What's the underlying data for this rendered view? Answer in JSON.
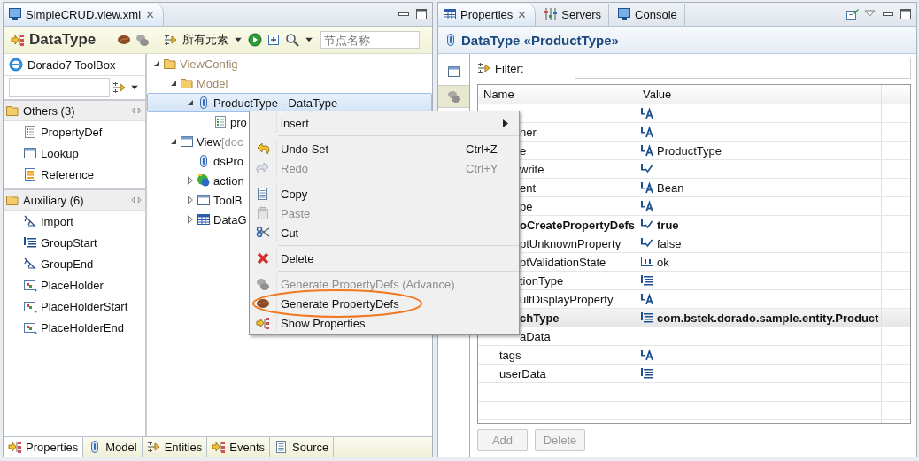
{
  "editor": {
    "tab": {
      "title": "SimpleCRUD.view.xml"
    },
    "toolbar": {
      "title": "DataType",
      "filter_label": "所有元素",
      "search_placeholder": "节点名称"
    },
    "toolbox": {
      "title": "Dorado7 ToolBox",
      "groups": [
        {
          "label": "Others (3)",
          "items": [
            "PropertyDef",
            "Lookup",
            "Reference"
          ]
        },
        {
          "label": "Auxiliary (6)",
          "items": [
            "Import",
            "GroupStart",
            "GroupEnd",
            "PlaceHolder",
            "PlaceHolderStart",
            "PlaceHolderEnd"
          ]
        }
      ]
    },
    "tree": [
      {
        "label": "ViewConfig",
        "expanded": true,
        "dim": true,
        "selected": false,
        "children": [
          {
            "label": "Model",
            "expanded": true,
            "dim": true,
            "selected": false,
            "children": [
              {
                "label": "ProductType - DataType",
                "expanded": true,
                "dim": false,
                "selected": true,
                "children": [
                  {
                    "label": "pro",
                    "dim": false,
                    "selected": false
                  }
                ]
              }
            ]
          },
          {
            "label": "View",
            "note": "[doc",
            "expanded": true,
            "dim": false,
            "selected": false,
            "children": [
              {
                "label": "dsPro",
                "dim": false,
                "selected": false
              },
              {
                "label": "action",
                "expanded": false,
                "dim": false,
                "selected": false
              },
              {
                "label": "ToolB",
                "expanded": false,
                "dim": false,
                "selected": false
              },
              {
                "label": "DataG",
                "expanded": false,
                "dim": false,
                "selected": false
              }
            ]
          }
        ]
      }
    ],
    "bottom_tabs": [
      {
        "label": "Properties",
        "selected": true
      },
      {
        "label": "Model",
        "selected": false
      },
      {
        "label": "Entities",
        "selected": false
      },
      {
        "label": "Events",
        "selected": false
      },
      {
        "label": "Source",
        "selected": false
      }
    ]
  },
  "properties": {
    "tabs": [
      {
        "label": "Properties",
        "selected": true
      },
      {
        "label": "Servers",
        "selected": false
      },
      {
        "label": "Console",
        "selected": false
      }
    ],
    "title": "DataType «ProductType»",
    "side_tabs": [
      {
        "selected": false
      },
      {
        "selected": true
      }
    ],
    "filter_label": "Filter:",
    "columns": [
      "Name",
      "Value"
    ],
    "rows": [
      {
        "kind": "text",
        "selected": false
      },
      {
        "name": "ner",
        "kind": "text",
        "clipped": true,
        "bold": false,
        "selected": false
      },
      {
        "name": "e",
        "kind": "text",
        "value": "ProductType",
        "clipped": true,
        "bold": false,
        "selected": false
      },
      {
        "name": "write",
        "kind": "bool",
        "clipped": true,
        "bold": false,
        "selected": false
      },
      {
        "name": "ent",
        "kind": "text",
        "value": "Bean",
        "clipped": true,
        "bold": false,
        "selected": false
      },
      {
        "name": "pe",
        "kind": "text",
        "clipped": true,
        "bold": false,
        "selected": false
      },
      {
        "name": "oCreatePropertyDefs",
        "kind": "bool",
        "value": "true",
        "clipped": true,
        "bold": true,
        "selected": false
      },
      {
        "name": "ptUnknownProperty",
        "kind": "bool",
        "value": "false",
        "clipped": true,
        "bold": false,
        "selected": false
      },
      {
        "name": "ptValidationState",
        "kind": "number",
        "value": "ok",
        "clipped": true,
        "bold": false,
        "selected": false
      },
      {
        "name": "tionType",
        "kind": "list",
        "clipped": true,
        "bold": false,
        "selected": false
      },
      {
        "name": "ultDisplayProperty",
        "kind": "text",
        "clipped": true,
        "bold": false,
        "selected": false
      },
      {
        "name": "chType",
        "kind": "list",
        "value": "com.bstek.dorado.sample.entity.Product",
        "clipped": true,
        "bold": true,
        "selected": true
      },
      {
        "name": "aData",
        "kind": "none",
        "clipped": true,
        "bold": false,
        "selected": false
      },
      {
        "name": "tags",
        "kind": "text",
        "clipped": false,
        "bold": false,
        "selected": false
      },
      {
        "name": "userData",
        "kind": "list",
        "clipped": false,
        "bold": false,
        "selected": false
      }
    ],
    "buttons": [
      {
        "label": "Add",
        "disabled": true
      },
      {
        "label": "Delete",
        "disabled": true
      }
    ]
  },
  "context_menu": {
    "groups": [
      [
        {
          "label": "insert",
          "submenu": true,
          "disabled": false,
          "circled": false
        }
      ],
      [
        {
          "label": "Undo Set",
          "shortcut": "Ctrl+Z",
          "disabled": false,
          "circled": false
        },
        {
          "label": "Redo",
          "shortcut": "Ctrl+Y",
          "disabled": true,
          "circled": false
        }
      ],
      [
        {
          "label": "Copy",
          "disabled": false,
          "circled": false
        },
        {
          "label": "Paste",
          "disabled": true,
          "circled": false
        },
        {
          "label": "Cut",
          "disabled": false,
          "circled": false
        }
      ],
      [
        {
          "label": "Delete",
          "disabled": false,
          "circled": false
        }
      ],
      [
        {
          "label": "Generate PropertyDefs (Advance)",
          "disabled": true,
          "circled": false
        },
        {
          "label": "Generate PropertyDefs",
          "disabled": false,
          "circled": true
        },
        {
          "label": "Show Properties",
          "disabled": false,
          "circled": false
        }
      ]
    ]
  }
}
